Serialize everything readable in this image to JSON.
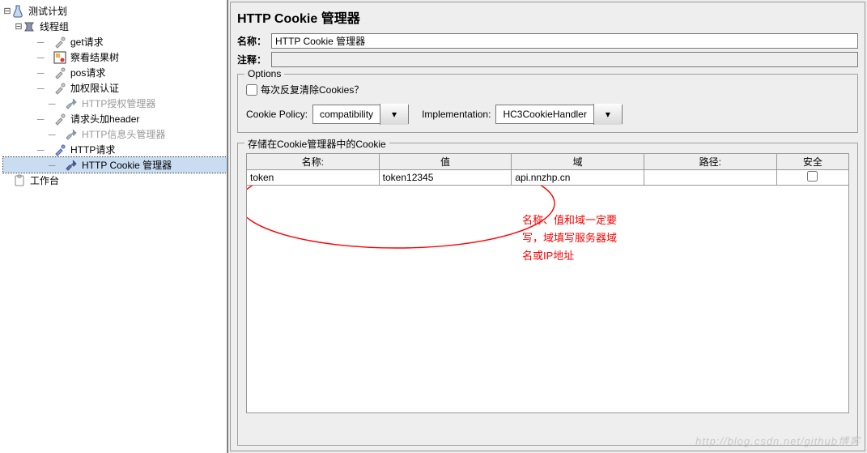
{
  "tree": {
    "root": "测试计划",
    "thread_group": "线程组",
    "items": [
      "get请求",
      "察看结果树",
      "pos请求",
      "加权限认证",
      "HTTP授权管理器",
      "请求头加header",
      "HTTP信息头管理器",
      "HTTP请求",
      "HTTP Cookie 管理器"
    ],
    "workbench": "工作台"
  },
  "main": {
    "title": "HTTP Cookie 管理器",
    "name_label": "名称：",
    "name_value": "HTTP Cookie 管理器",
    "comment_label": "注释：",
    "options_legend": "Options",
    "clear_each_iter": "每次反复清除Cookies？",
    "cookie_policy_label": "Cookie Policy:",
    "cookie_policy_value": "compatibility",
    "implementation_label": "Implementation:",
    "implementation_value": "HC3CookieHandler",
    "stored_legend": "存储在Cookie管理器中的Cookie",
    "headers": {
      "name": "名称:",
      "value": "值",
      "domain": "域",
      "path": "路径:",
      "secure": "安全"
    },
    "row": {
      "name": "token",
      "value": "token12345",
      "domain": "api.nnzhp.cn",
      "path": "",
      "secure": false
    }
  },
  "annotation": {
    "l1": "名称、值和域一定要",
    "l2": "写，域填写服务器域",
    "l3": "名或IP地址"
  },
  "watermark": "http://blog.csdn.net/github博客"
}
